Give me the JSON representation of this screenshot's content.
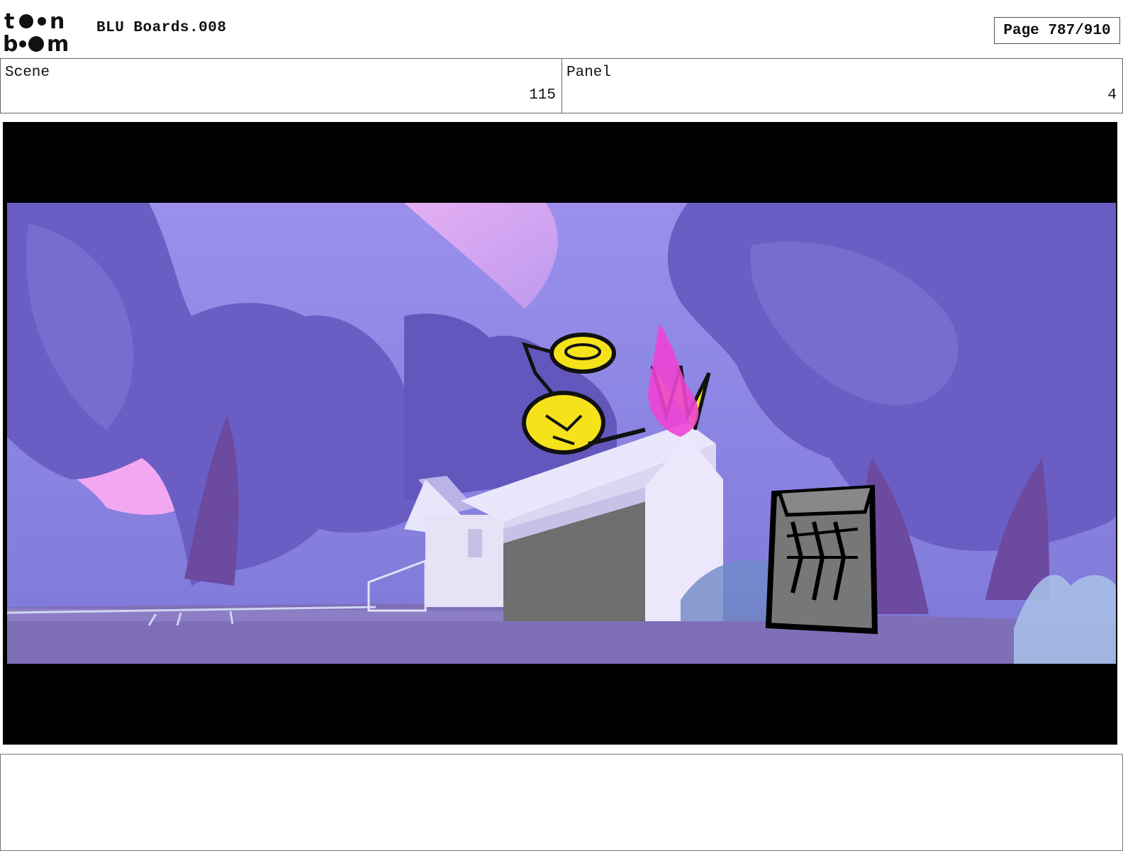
{
  "header": {
    "logo_text": "toon boom",
    "document_title": "BLU Boards.008",
    "page_indicator": "Page 787/910"
  },
  "info": {
    "scene_label": "Scene",
    "scene_value": "115",
    "panel_label": "Panel",
    "panel_value": "4"
  },
  "notes": {
    "text": ""
  },
  "colors": {
    "sky": "#8a86e8",
    "pink_clouds": "#f0a8f0",
    "foliage": "#6b5fc4",
    "ground": "#7e6fb8",
    "character": "#f5e21a",
    "magenta_splash": "#f040d0",
    "letterbox": "#000000"
  },
  "panel_image": {
    "elements": [
      "purple-trees",
      "house-with-garage",
      "trash-can",
      "yellow-character",
      "pink-splash"
    ]
  }
}
